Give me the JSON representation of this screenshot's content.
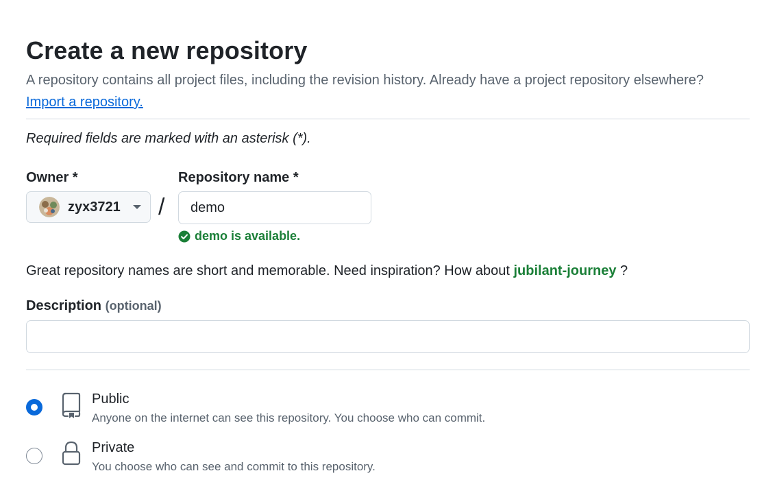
{
  "page": {
    "title": "Create a new repository",
    "subtitle": "A repository contains all project files, including the revision history. Already have a project repository elsewhere?",
    "import_link": "Import a repository.",
    "required_note": "Required fields are marked with an asterisk (*)."
  },
  "owner": {
    "label": "Owner *",
    "value": "zyx3721"
  },
  "separator": "/",
  "repo_name": {
    "label": "Repository name *",
    "value": "demo",
    "availability": "demo is available."
  },
  "inspiration": {
    "prefix": "Great repository names are short and memorable. Need inspiration? How about",
    "suggestion": "jubilant-journey",
    "suffix": "?"
  },
  "description": {
    "label": "Description",
    "optional": "(optional)",
    "value": ""
  },
  "visibility": {
    "options": [
      {
        "title": "Public",
        "desc": "Anyone on the internet can see this repository. You choose who can commit.",
        "selected": true,
        "icon": "repo-icon"
      },
      {
        "title": "Private",
        "desc": "You choose who can see and commit to this repository.",
        "selected": false,
        "icon": "lock-icon"
      }
    ]
  },
  "colors": {
    "link": "#0969da",
    "success": "#1a7f37",
    "muted": "#59636e",
    "border": "#d1d9e0"
  }
}
